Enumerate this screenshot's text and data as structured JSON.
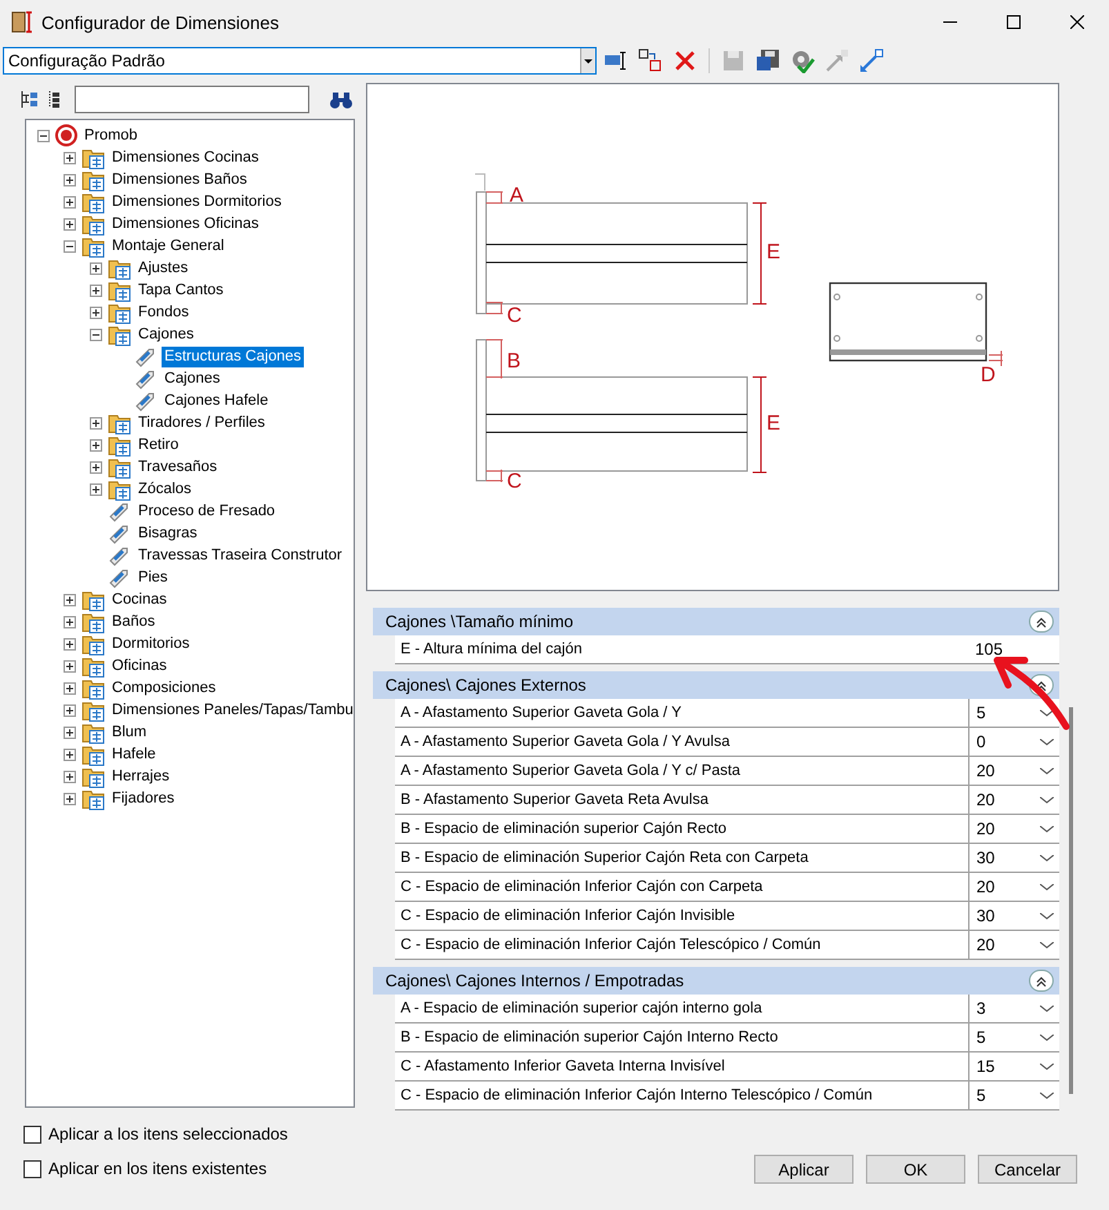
{
  "window": {
    "title": "Configurador de Dimensiones"
  },
  "toolbar": {
    "configuration": "Configuração Padrão",
    "tools": [
      {
        "disabled": false
      },
      {
        "disabled": false
      },
      {
        "disabled": false
      },
      {
        "disabled": true
      },
      {
        "disabled": false
      },
      {
        "disabled": false
      },
      {
        "disabled": true
      },
      {
        "disabled": false
      }
    ]
  },
  "tree": {
    "items": [
      {
        "label": "Promob",
        "kind": "root",
        "expanded": true,
        "selected": false,
        "children": [
          {
            "label": "Dimensiones Cocinas",
            "kind": "folder",
            "expanded": false,
            "selected": false
          },
          {
            "label": "Dimensiones Baños",
            "kind": "folder",
            "expanded": false,
            "selected": false
          },
          {
            "label": "Dimensiones Dormitorios",
            "kind": "folder",
            "expanded": false,
            "selected": false
          },
          {
            "label": "Dimensiones Oficinas",
            "kind": "folder",
            "expanded": false,
            "selected": false
          },
          {
            "label": "Montaje General",
            "kind": "folder",
            "expanded": true,
            "selected": false,
            "children": [
              {
                "label": "Ajustes",
                "kind": "folder",
                "expanded": false,
                "selected": false
              },
              {
                "label": "Tapa Cantos",
                "kind": "folder",
                "expanded": false,
                "selected": false
              },
              {
                "label": "Fondos",
                "kind": "folder",
                "expanded": false,
                "selected": false
              },
              {
                "label": "Cajones",
                "kind": "folder",
                "expanded": true,
                "selected": false,
                "children": [
                  {
                    "label": "Estructuras Cajones",
                    "kind": "setting",
                    "selected": true
                  },
                  {
                    "label": "Cajones",
                    "kind": "setting",
                    "selected": false
                  },
                  {
                    "label": "Cajones Hafele",
                    "kind": "setting",
                    "selected": false
                  }
                ]
              },
              {
                "label": "Tiradores / Perfiles",
                "kind": "folder",
                "expanded": false,
                "selected": false
              },
              {
                "label": "Retiro",
                "kind": "folder",
                "expanded": false,
                "selected": false
              },
              {
                "label": "Travesaños",
                "kind": "folder",
                "expanded": false,
                "selected": false
              },
              {
                "label": "Zócalos",
                "kind": "folder",
                "expanded": false,
                "selected": false
              },
              {
                "label": "Proceso de Fresado",
                "kind": "setting",
                "selected": false
              },
              {
                "label": "Bisagras",
                "kind": "setting",
                "selected": false
              },
              {
                "label": "Travessas Traseira Construtor",
                "kind": "setting",
                "selected": false
              },
              {
                "label": "Pies",
                "kind": "setting",
                "selected": false
              }
            ]
          },
          {
            "label": "Cocinas",
            "kind": "folder",
            "expanded": false,
            "selected": false
          },
          {
            "label": "Baños",
            "kind": "folder",
            "expanded": false,
            "selected": false
          },
          {
            "label": "Dormitorios",
            "kind": "folder",
            "expanded": false,
            "selected": false
          },
          {
            "label": "Oficinas",
            "kind": "folder",
            "expanded": false,
            "selected": false
          },
          {
            "label": "Composiciones",
            "kind": "folder",
            "expanded": false,
            "selected": false
          },
          {
            "label": "Dimensiones Paneles/Tapas/Tambu",
            "kind": "folder",
            "expanded": false,
            "selected": false
          },
          {
            "label": "Blum",
            "kind": "folder",
            "expanded": false,
            "selected": false
          },
          {
            "label": "Hafele",
            "kind": "folder",
            "expanded": false,
            "selected": false
          },
          {
            "label": "Herrajes",
            "kind": "folder",
            "expanded": false,
            "selected": false
          },
          {
            "label": "Fijadores",
            "kind": "folder",
            "expanded": false,
            "selected": false
          }
        ]
      }
    ]
  },
  "diagram": {
    "labels": [
      "A",
      "E",
      "C",
      "B",
      "E",
      "C",
      "D"
    ]
  },
  "properties": {
    "sections": [
      {
        "title": "Cajones \\Tamaño mínimo",
        "expanded": true,
        "rows": [
          {
            "label": "E - Altura mínima del cajón",
            "value": "105",
            "kind": "text"
          }
        ]
      },
      {
        "title": "Cajones\\ Cajones Externos",
        "expanded": true,
        "rows": [
          {
            "label": "A - Afastamento Superior Gaveta Gola / Y",
            "value": "5",
            "kind": "dropdown"
          },
          {
            "label": "A - Afastamento Superior Gaveta Gola / Y Avulsa",
            "value": "0",
            "kind": "dropdown"
          },
          {
            "label": "A - Afastamento Superior Gaveta Gola / Y c/ Pasta",
            "value": "20",
            "kind": "dropdown"
          },
          {
            "label": "B - Afastamento Superior Gaveta Reta Avulsa",
            "value": "20",
            "kind": "dropdown"
          },
          {
            "label": "B - Espacio de eliminación superior Cajón Recto",
            "value": "20",
            "kind": "dropdown"
          },
          {
            "label": "B - Espacio de eliminación Superior Cajón Reta con Carpeta",
            "value": "30",
            "kind": "dropdown"
          },
          {
            "label": "C - Espacio de eliminación Inferior Cajón con Carpeta",
            "value": "20",
            "kind": "dropdown"
          },
          {
            "label": "C - Espacio de eliminación Inferior Cajón Invisible",
            "value": "30",
            "kind": "dropdown"
          },
          {
            "label": "C - Espacio de eliminación Inferior Cajón Telescópico / Común",
            "value": "20",
            "kind": "dropdown"
          }
        ]
      },
      {
        "title": "Cajones\\ Cajones Internos / Empotradas",
        "expanded": true,
        "rows": [
          {
            "label": "A - Espacio de eliminación superior cajón interno gola",
            "value": "3",
            "kind": "dropdown"
          },
          {
            "label": "B - Espacio de eliminación superior Cajón Interno Recto",
            "value": "5",
            "kind": "dropdown"
          },
          {
            "label": "C - Afastamento Inferior Gaveta Interna Invisível",
            "value": "15",
            "kind": "dropdown"
          },
          {
            "label": "C - Espacio de eliminación Inferior Cajón Interno Telescópico / Común",
            "value": "5",
            "kind": "dropdown"
          }
        ]
      }
    ]
  },
  "options": [
    {
      "label": "Aplicar a los itens seleccionados",
      "checked": false
    },
    {
      "label": "Aplicar en los itens existentes",
      "checked": false
    }
  ],
  "buttons": [
    "Aplicar",
    "OK",
    "Cancelar"
  ]
}
